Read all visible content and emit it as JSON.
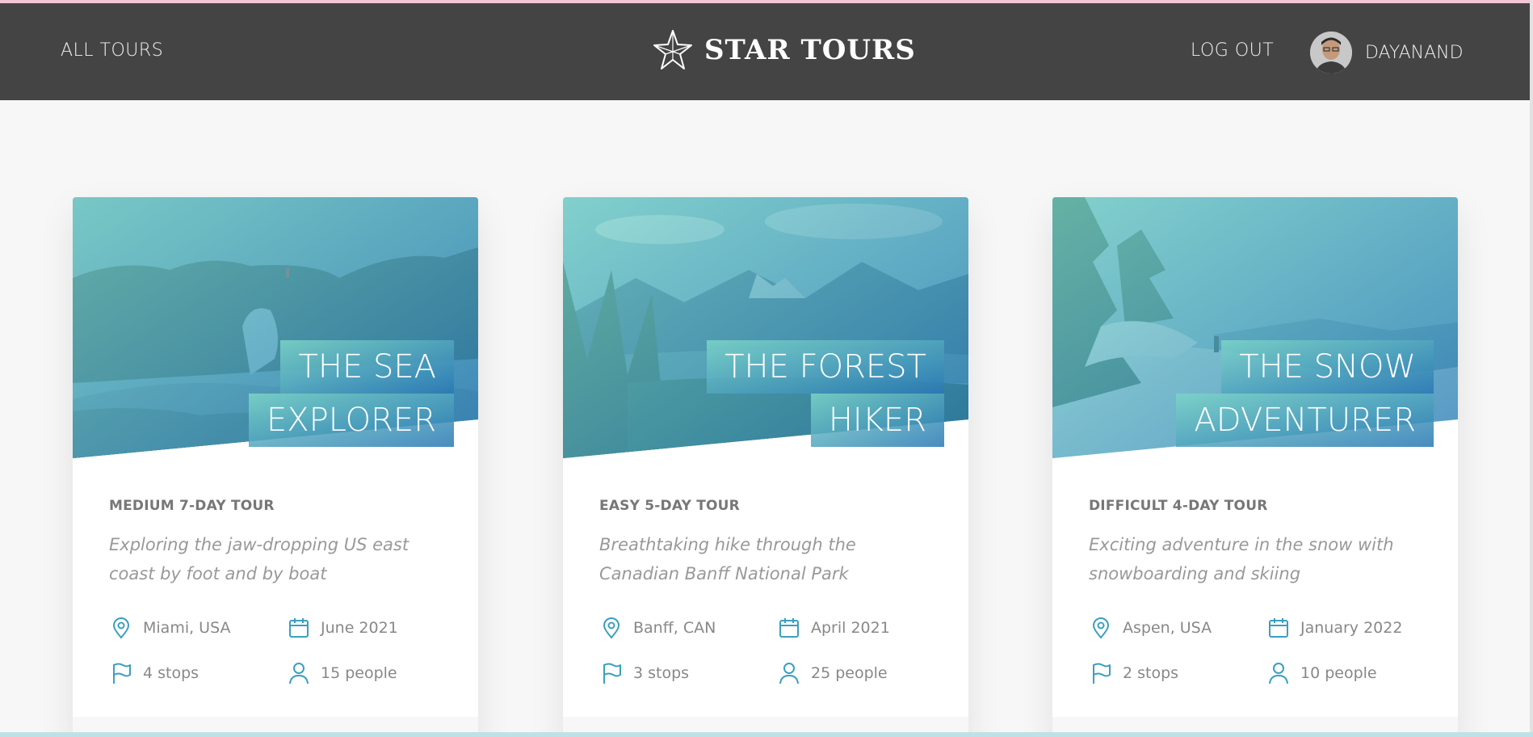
{
  "nav": {
    "all_tours": "ALL TOURS",
    "brand": "STAR TOURS",
    "log_out": "LOG OUT",
    "user_name": "DAYANAND"
  },
  "tours": [
    {
      "title_line_1": "THE SEA",
      "title_line_2": "EXPLORER",
      "subheading": "MEDIUM 7-DAY TOUR",
      "summary": "Exploring the jaw-dropping US east coast by foot and by boat",
      "location": "Miami, USA",
      "date": "June 2021",
      "stops": "4 stops",
      "people": "15 people"
    },
    {
      "title_line_1": "THE FOREST",
      "title_line_2": "HIKER",
      "subheading": "EASY 5-DAY TOUR",
      "summary": "Breathtaking hike through the Canadian Banff National Park",
      "location": "Banff, CAN",
      "date": "April 2021",
      "stops": "3 stops",
      "people": "25 people"
    },
    {
      "title_line_1": "THE SNOW",
      "title_line_2": "ADVENTURER",
      "subheading": "DIFFICULT 4-DAY TOUR",
      "summary": "Exciting adventure in the snow with snowboarding and skiing",
      "location": "Aspen, USA",
      "date": "January 2022",
      "stops": "2 stops",
      "people": "10 people"
    }
  ],
  "icons": {
    "logo": "star-logo-icon",
    "location": "map-pin-icon",
    "date": "calendar-icon",
    "stops": "flag-icon",
    "people": "user-icon"
  },
  "colors": {
    "nav_bg": "#444444",
    "accent": "#55c57a",
    "icon": "#3b9fbf",
    "gradient_start": "#7dd5c8",
    "gradient_end": "#2878b4"
  }
}
